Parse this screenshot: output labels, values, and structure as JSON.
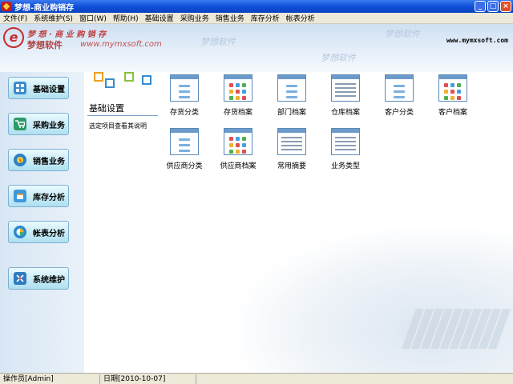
{
  "window": {
    "title": "梦想-商业购销存"
  },
  "menu": [
    "文件(F)",
    "系统维护(S)",
    "窗口(W)",
    "帮助(H)",
    "基础设置",
    "采购业务",
    "销售业务",
    "库存分析",
    "帐表分析"
  ],
  "banner": {
    "brand_line": "梦 想 · 商 业 购 销 存",
    "brand_name": "梦想软件",
    "url": "www.mymxsoft.com",
    "site": "www.mymxsoft.com",
    "watermark": "梦想软件"
  },
  "sidebar": [
    {
      "label": "基础设置",
      "icon": "grid-icon"
    },
    {
      "label": "采购业务",
      "icon": "cart-icon"
    },
    {
      "label": "销售业务",
      "icon": "coin-icon"
    },
    {
      "label": "库存分析",
      "icon": "box-icon"
    },
    {
      "label": "帐表分析",
      "icon": "pie-chart-icon"
    },
    {
      "label": "系统维护",
      "icon": "tools-icon"
    }
  ],
  "section": {
    "title": "基础设置",
    "hint": "选定项目查看其说明"
  },
  "tiles": [
    {
      "label": "存货分类",
      "style": "list-icon"
    },
    {
      "label": "存货档案",
      "style": "grid-icon"
    },
    {
      "label": "部门档案",
      "style": "list-icon"
    },
    {
      "label": "仓库档案",
      "style": "lines-icon"
    },
    {
      "label": "客户分类",
      "style": "list-icon"
    },
    {
      "label": "客户档案",
      "style": "grid-icon"
    },
    {
      "label": "供应商分类",
      "style": "list-icon"
    },
    {
      "label": "供应商档案",
      "style": "grid-icon"
    },
    {
      "label": "常用摘要",
      "style": "lines-icon"
    },
    {
      "label": "业务类型",
      "style": "lines-icon"
    }
  ],
  "status": {
    "operator": "操作员[Admin]",
    "date": "日期[2010-10-07]"
  },
  "colors": {
    "titlebar": "#0f50d8",
    "sidebar_button": "#aee0f0",
    "accent": "#6c9acb"
  }
}
